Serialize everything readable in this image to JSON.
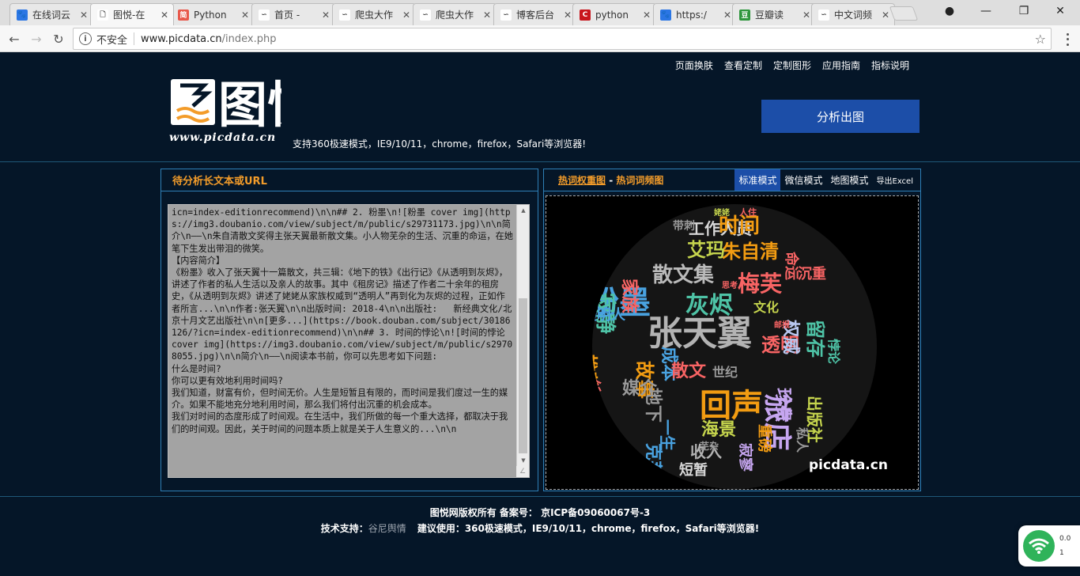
{
  "browser": {
    "tabs": [
      {
        "title": "在线词云",
        "fav_color": "#2b76e4",
        "fav_glyph": "🐾",
        "active": false
      },
      {
        "title": "图悦-在",
        "fav_color": "#ffffff",
        "fav_glyph": "🗋",
        "active": true
      },
      {
        "title": "Python",
        "fav_color": "#e8584b",
        "fav_glyph": "简",
        "active": false
      },
      {
        "title": "首页 -",
        "fav_color": "#ffffff",
        "fav_glyph": "∽",
        "active": false
      },
      {
        "title": "爬虫大作",
        "fav_color": "#ffffff",
        "fav_glyph": "∽",
        "active": false
      },
      {
        "title": "爬虫大作",
        "fav_color": "#ffffff",
        "fav_glyph": "∽",
        "active": false
      },
      {
        "title": "博客后台",
        "fav_color": "#ffffff",
        "fav_glyph": "∽",
        "active": false
      },
      {
        "title": "python",
        "fav_color": "#c8161d",
        "fav_glyph": "C",
        "active": false
      },
      {
        "title": "https:/",
        "fav_color": "#2b76e4",
        "fav_glyph": "🐾",
        "active": false
      },
      {
        "title": "豆瓣读",
        "fav_color": "#2e963d",
        "fav_glyph": "豆",
        "active": false
      },
      {
        "title": "中文词频",
        "fav_color": "#ffffff",
        "fav_glyph": "∽",
        "active": false
      }
    ],
    "security_label": "不安全",
    "url_host": "www.picdata.cn",
    "url_path": "/index.php"
  },
  "site": {
    "nav": [
      "页面换肤",
      "查看定制",
      "定制图形",
      "应用指南",
      "指标说明"
    ],
    "logo_text": "图悦",
    "logo_url": "www.picdata.cn",
    "support_msg": "支持360极速模式，IE9/10/11，chrome，firefox，Safari等浏览器!",
    "analyze_button": "分析出图"
  },
  "input_panel": {
    "title": "待分析长文本或URL",
    "text": "icn=index-editionrecommend)\\n\\n## 2. 粉墨\\n![粉墨 cover img](https://img3.doubanio.com/view/subject/m/public/s29731173.jpg)\\n\\n简介\\n——\\n朱自清散文奖得主张天翼最新散文集。小人物芜杂的生活、沉重的命运，在她笔下生发出带泪的微笑。\n【内容简介】\n《粉墨》收入了张天翼十一篇散文，共三辑：《地下的铁》《出行记》《从透明到灰烬》，讲述了作者的私人生活以及亲人的故事。其中《租房记》描述了作者二十余年的租房史，《从透明到灰烬》讲述了姥姥从家族权威到“透明人”再到化为灰烬的过程，正如作者所言...\\n\\n作者:张天翼\\n\\n出版时间: 2018-4\\n\\n出版社:   新经典文化/北京十月文艺出版社\\n\\n[更多...](https://book.douban.com/subject/30186126/?icn=index-editionrecommend)\\n\\n## 3. 时间的悖论\\n![时间的悖论 cover img](https://img3.doubanio.com/view/subject/m/public/s29708055.jpg)\\n\\n简介\\n——\\n阅读本书前，你可以先思考如下问题:\n什么是时间?\n你可以更有效地利用时间吗?\n我们知道，财富有价，但时间无价。人生是短暂且有限的，而时间是我们度过一生的媒介。如果不能地充分地利用时间，那么我们将付出沉重的机会成本。\n我们对时间的态度形成了时间观。在生活中，我们所做的每一个重大选择，都取决于我们的时间观。因此，关于时间的问题本质上就是关于人生意义的...\\n\\n"
  },
  "output_panel": {
    "title_a": "热词权重图",
    "title_sep": " - ",
    "title_b": "热词词频图",
    "modes": [
      "标准模式",
      "微信模式",
      "地图模式",
      "导出Excel"
    ],
    "watermark": "picdata.cn",
    "words": [
      {
        "t": "张天翼",
        "c": "#b3b3b3"
      },
      {
        "t": "粉墨",
        "c": "#49a2e0"
      },
      {
        "t": "回声",
        "c": "#f29c12"
      },
      {
        "t": "旅店",
        "c": "#c6a6f0"
      },
      {
        "t": "灰烬",
        "c": "#4ec3a6"
      },
      {
        "t": "梅芙",
        "c": "#f86464"
      },
      {
        "t": "散文集",
        "c": "#bababa"
      },
      {
        "t": "朱自清",
        "c": "#f29c12"
      },
      {
        "t": "工作人员",
        "c": "#d8d8d8"
      },
      {
        "t": "艾玛",
        "c": "#c5d44d"
      },
      {
        "t": "家族",
        "c": "#f86464"
      },
      {
        "t": "寂静",
        "c": "#4ec3a6"
      },
      {
        "t": "沉重",
        "c": "#f86464"
      },
      {
        "t": "透明",
        "c": "#f86464"
      },
      {
        "t": "权威",
        "c": "#b8c7f0"
      },
      {
        "t": "推荐书",
        "c": "#f29c12"
      },
      {
        "t": "故事",
        "c": "#f29c12"
      },
      {
        "t": "成本",
        "c": "#49a2e0"
      },
      {
        "t": "散文",
        "c": "#f86464"
      },
      {
        "t": "世纪",
        "c": "#999999"
      },
      {
        "t": "文化",
        "c": "#c5d44d"
      },
      {
        "t": "媒介",
        "c": "#999999"
      },
      {
        "t": "地下",
        "c": "#999999"
      },
      {
        "t": "克莱儿",
        "c": "#49a2e0"
      },
      {
        "t": "海景",
        "c": "#c5d44d"
      },
      {
        "t": "收入",
        "c": "#b3b3b3"
      },
      {
        "t": "短暂",
        "c": "#d8d8d8"
      },
      {
        "t": "出版社",
        "c": "#c5d44d"
      },
      {
        "t": "珍贵",
        "c": "#c6a6f0"
      },
      {
        "t": "留存",
        "c": "#4ec3a6"
      },
      {
        "t": "重磅",
        "c": "#f29c12"
      },
      {
        "t": "寂寥",
        "c": "#c6a6f0"
      },
      {
        "t": "私人",
        "c": "#999999"
      },
      {
        "t": "带刺",
        "c": "#999999"
      },
      {
        "t": "人住",
        "c": "#f86464"
      },
      {
        "t": "思考",
        "c": "#f86464"
      },
      {
        "t": "姥姥",
        "c": "#c5d44d"
      },
      {
        "t": "邮报",
        "c": "#f86464"
      },
      {
        "t": "一生",
        "c": "#49a2e0"
      },
      {
        "t": "芜杂",
        "c": "#999999"
      },
      {
        "t": "中国",
        "c": "#c5d44d"
      },
      {
        "t": "透明人",
        "c": "#49a2e0"
      },
      {
        "t": "时间",
        "c": "#f29c12"
      },
      {
        "t": "命运",
        "c": "#f86464"
      },
      {
        "t": "悖论",
        "c": "#4ec3a6"
      },
      {
        "t": "出版",
        "c": "#49a2e0"
      },
      {
        "t": "古籍",
        "c": "#f29c12"
      },
      {
        "t": "念",
        "c": "#f86464"
      }
    ]
  },
  "footer": {
    "line1": "图悦网版权所有 备案号： 京ICP备09060067号-3",
    "support_prefix": "技术支持：",
    "support_company": "谷尼舆情",
    "suggest": "建议使用：360极速模式，IE9/10/11，chrome，firefox，Safari等浏览器!"
  },
  "tray": {
    "speed_up": "0.0",
    "speed_down": "1"
  }
}
